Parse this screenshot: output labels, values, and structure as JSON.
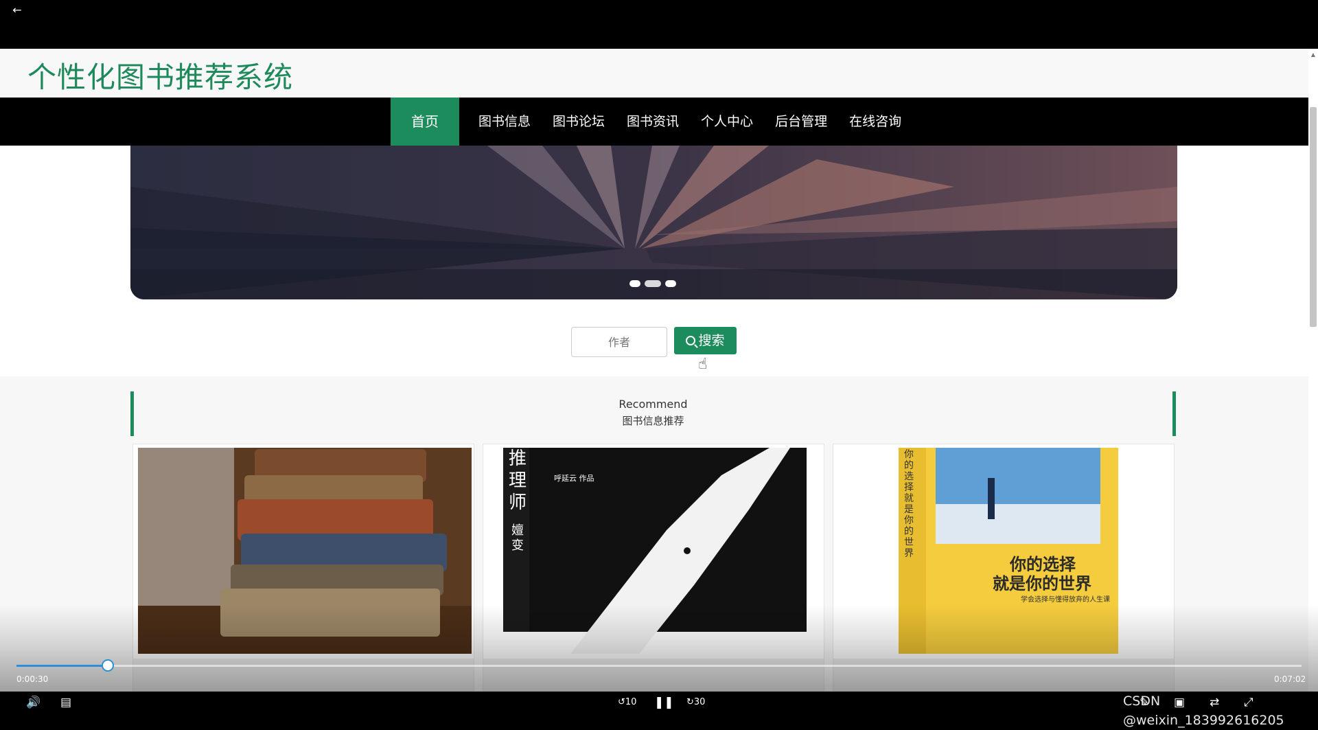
{
  "header": {
    "site_title": "个性化图书推荐系统"
  },
  "nav": {
    "items": [
      {
        "label": "首页"
      },
      {
        "label": "图书信息"
      },
      {
        "label": "图书论坛"
      },
      {
        "label": "图书资讯"
      },
      {
        "label": "个人中心"
      },
      {
        "label": "后台管理"
      },
      {
        "label": "在线咨询"
      }
    ],
    "active_index": 0
  },
  "search": {
    "placeholder": "作者",
    "button_label": "搜索"
  },
  "recommend": {
    "title_en": "Recommend",
    "title_cn": "图书信息推荐"
  },
  "cards": [
    {
      "cover_text": []
    },
    {
      "cover_text": [
        "推理师",
        "嬗变",
        "呼延云 作品"
      ]
    },
    {
      "cover_text": [
        "你的选择就是你的世界",
        "你的选择",
        "就是你的世界",
        "学会选择与懂得放弃的人生课"
      ]
    }
  ],
  "player": {
    "current_time": "0:00:30",
    "total_time": "0:07:02",
    "progress": 0.071,
    "skip_back": "10",
    "skip_forward": "30"
  },
  "watermark": "CSDN @weixin_183992616205"
}
